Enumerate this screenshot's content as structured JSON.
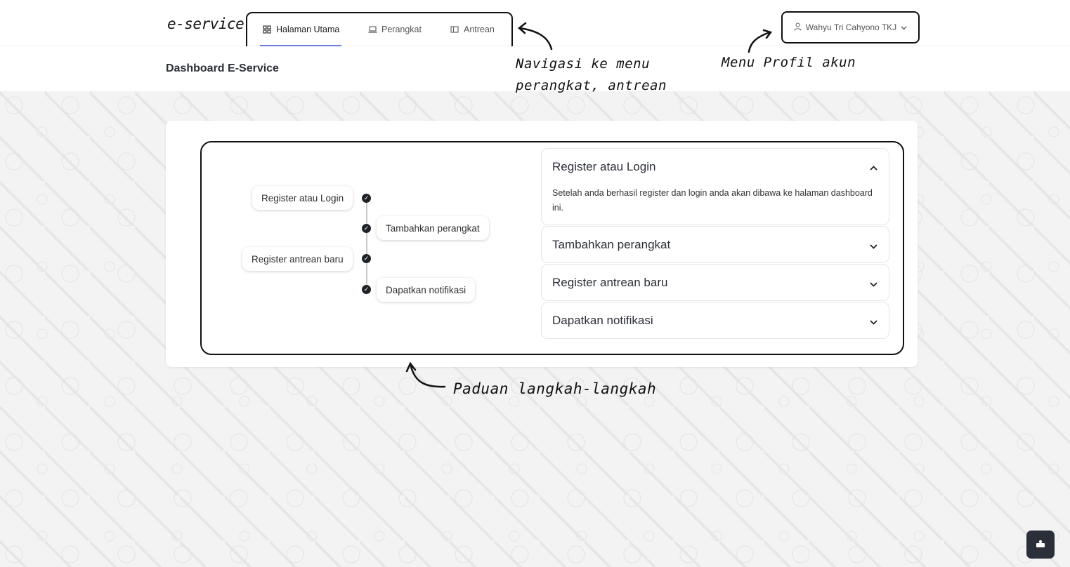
{
  "brand": "e-service",
  "nav": {
    "items": [
      {
        "label": "Halaman Utama",
        "icon": "grid-icon"
      },
      {
        "label": "Perangkat",
        "icon": "laptop-icon"
      },
      {
        "label": "Antrean",
        "icon": "board-icon"
      }
    ]
  },
  "profile": {
    "name": "Wahyu Tri Cahyono TKJ",
    "icon": "user-icon"
  },
  "page_title": "Dashboard E-Service",
  "timeline": {
    "steps": [
      "Register atau Login",
      "Tambahkan perangkat",
      "Register antrean baru",
      "Dapatkan notifikasi"
    ]
  },
  "accordion": {
    "items": [
      {
        "title": "Register atau Login",
        "body": "Setelah anda berhasil register dan login anda akan dibawa ke halaman dashboard ini.",
        "expanded": true
      },
      {
        "title": "Tambahkan perangkat",
        "expanded": false
      },
      {
        "title": "Register antrean baru",
        "expanded": false
      },
      {
        "title": "Dapatkan notifikasi",
        "expanded": false
      }
    ]
  },
  "annotations": {
    "nav_line1": "Navigasi ke menu",
    "nav_line2": "perangkat, antrean",
    "profile": "Menu Profil akun",
    "guide": "Paduan langkah-langkah"
  },
  "colors": {
    "accent": "#6c7ae0",
    "check": "#1f2328",
    "fab": "#2a2f3a"
  }
}
